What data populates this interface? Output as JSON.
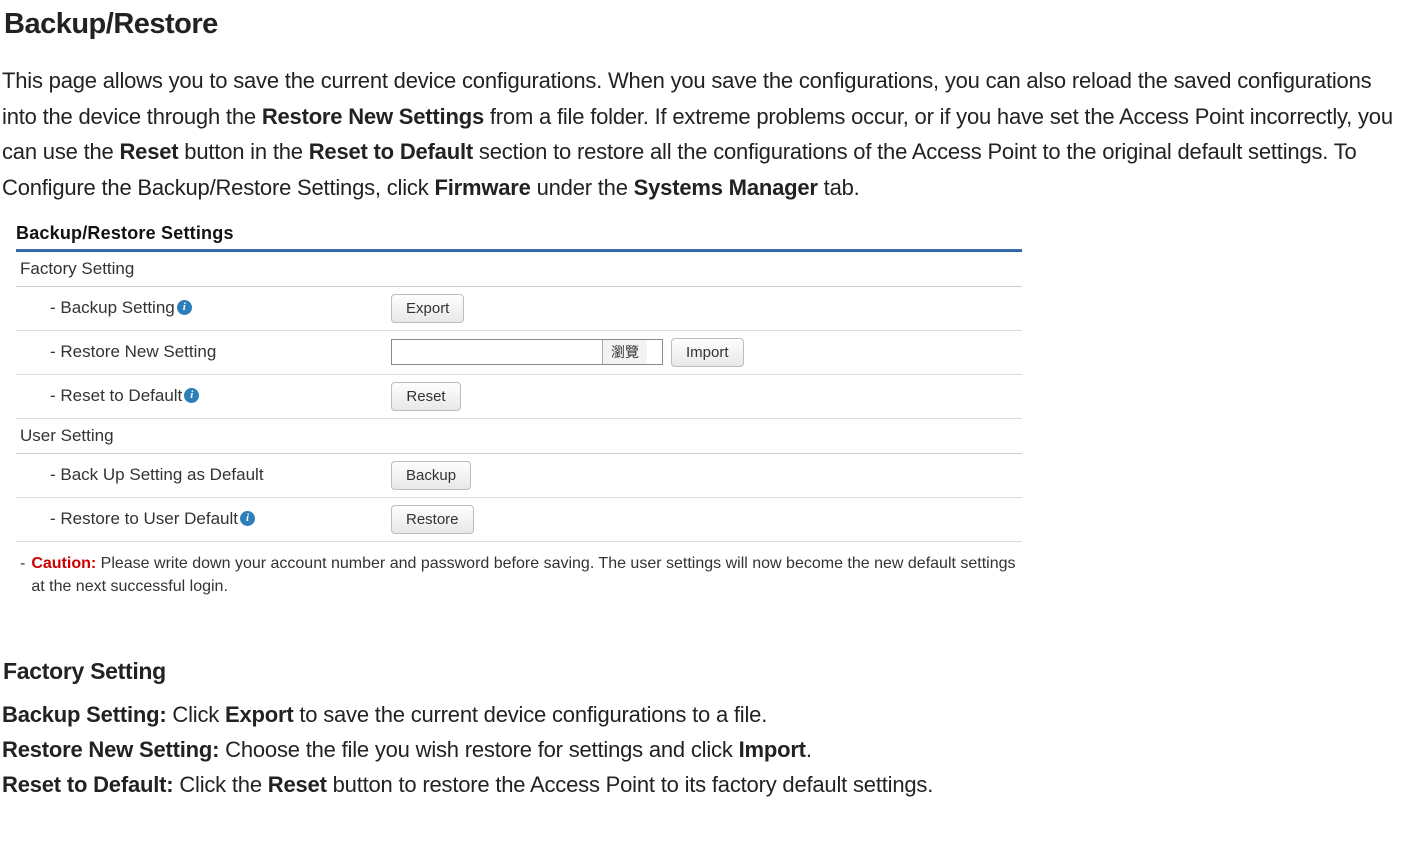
{
  "title": "Backup/Restore",
  "intro": {
    "text1": "This page allows you to save the current device configurations. When you save the configurations, you can also reload the saved configurations into the device through the ",
    "bold1": "Restore New Settings",
    "text2": " from a file folder. If extreme problems occur, or if you have set the Access Point incorrectly, you can use the ",
    "bold2": "Reset",
    "text3": " button in the ",
    "bold3": "Reset to Default",
    "text4": " section to restore all the configurations of the Access Point to the original default settings. To Configure the Backup/Restore Settings, click ",
    "bold4": "Firmware",
    "text5": " under the ",
    "bold5": "Systems Manager",
    "text6": " tab."
  },
  "panel": {
    "title": "Backup/Restore Settings",
    "factory": {
      "header": "Factory Setting",
      "backup_label": "- Backup Setting",
      "export_btn": "Export",
      "restore_label": "- Restore New Setting",
      "browse_btn": "瀏覽",
      "import_btn": "Import",
      "reset_label": "- Reset to Default",
      "reset_btn": "Reset"
    },
    "user": {
      "header": "User Setting",
      "backup_label": "- Back Up Setting as Default",
      "backup_btn": "Backup",
      "restore_label": "- Restore to User Default",
      "restore_btn": "Restore"
    },
    "caution": {
      "dash": "-",
      "label": "Caution:",
      "text": " Please write down your account number and password before saving. The user settings will now become the new default settings at the next successful login."
    }
  },
  "factory_section": {
    "title": "Factory Setting",
    "d1_label": "Backup Setting:",
    "d1_text": " Click ",
    "d1_bold": "Export",
    "d1_text2": " to save the current device configurations to a file.",
    "d2_label": "Restore New Setting:",
    "d2_text": " Choose the file you wish restore for settings and click ",
    "d2_bold": "Import",
    "d2_text2": ".",
    "d3_label": "Reset to Default:",
    "d3_text": " Click the ",
    "d3_bold": "Reset",
    "d3_text2": " button to restore the Access Point to its factory default settings."
  }
}
